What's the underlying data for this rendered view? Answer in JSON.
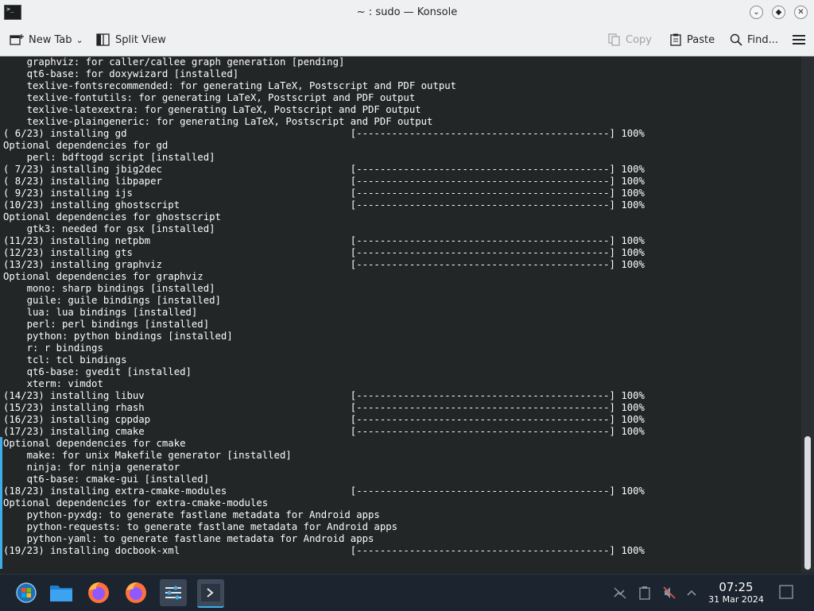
{
  "window": {
    "title": "~ : sudo — Konsole",
    "app_icon_text": ">_"
  },
  "toolbar": {
    "new_tab": "New Tab",
    "split_view": "Split View",
    "copy": "Copy",
    "paste": "Paste",
    "find": "Find..."
  },
  "terminal": {
    "lines": [
      "    graphviz: for caller/callee graph generation [pending]",
      "    qt6-base: for doxywizard [installed]",
      "    texlive-fontsrecommended: for generating LaTeX, Postscript and PDF output",
      "    texlive-fontutils: for generating LaTeX, Postscript and PDF output",
      "    texlive-latexextra: for generating LaTeX, Postscript and PDF output",
      "    texlive-plaingeneric: for generating LaTeX, Postscript and PDF output",
      "( 6/23) installing gd                                      [-------------------------------------------] 100%",
      "Optional dependencies for gd",
      "    perl: bdftogd script [installed]",
      "( 7/23) installing jbig2dec                                [-------------------------------------------] 100%",
      "( 8/23) installing libpaper                                [-------------------------------------------] 100%",
      "( 9/23) installing ijs                                     [-------------------------------------------] 100%",
      "(10/23) installing ghostscript                             [-------------------------------------------] 100%",
      "Optional dependencies for ghostscript",
      "    gtk3: needed for gsx [installed]",
      "(11/23) installing netpbm                                  [-------------------------------------------] 100%",
      "(12/23) installing gts                                     [-------------------------------------------] 100%",
      "(13/23) installing graphviz                                [-------------------------------------------] 100%",
      "Optional dependencies for graphviz",
      "    mono: sharp bindings [installed]",
      "    guile: guile bindings [installed]",
      "    lua: lua bindings [installed]",
      "    perl: perl bindings [installed]",
      "    python: python bindings [installed]",
      "    r: r bindings",
      "    tcl: tcl bindings",
      "    qt6-base: gvedit [installed]",
      "    xterm: vimdot",
      "(14/23) installing libuv                                   [-------------------------------------------] 100%",
      "(15/23) installing rhash                                   [-------------------------------------------] 100%",
      "(16/23) installing cppdap                                  [-------------------------------------------] 100%",
      "(17/23) installing cmake                                   [-------------------------------------------] 100%",
      "Optional dependencies for cmake",
      "    make: for unix Makefile generator [installed]",
      "    ninja: for ninja generator",
      "    qt6-base: cmake-gui [installed]",
      "(18/23) installing extra-cmake-modules                     [-------------------------------------------] 100%",
      "Optional dependencies for extra-cmake-modules",
      "    python-pyxdg: to generate fastlane metadata for Android apps",
      "    python-requests: to generate fastlane metadata for Android apps",
      "    python-yaml: to generate fastlane metadata for Android apps",
      "(19/23) installing docbook-xml                             [-------------------------------------------] 100%"
    ]
  },
  "taskbar": {
    "time": "07:25",
    "date": "31 Mar 2024"
  },
  "colors": {
    "terminal_bg": "#232627",
    "terminal_fg": "#fcfcfc",
    "accent": "#3daee9",
    "taskbar_bg": "#1c2430"
  }
}
